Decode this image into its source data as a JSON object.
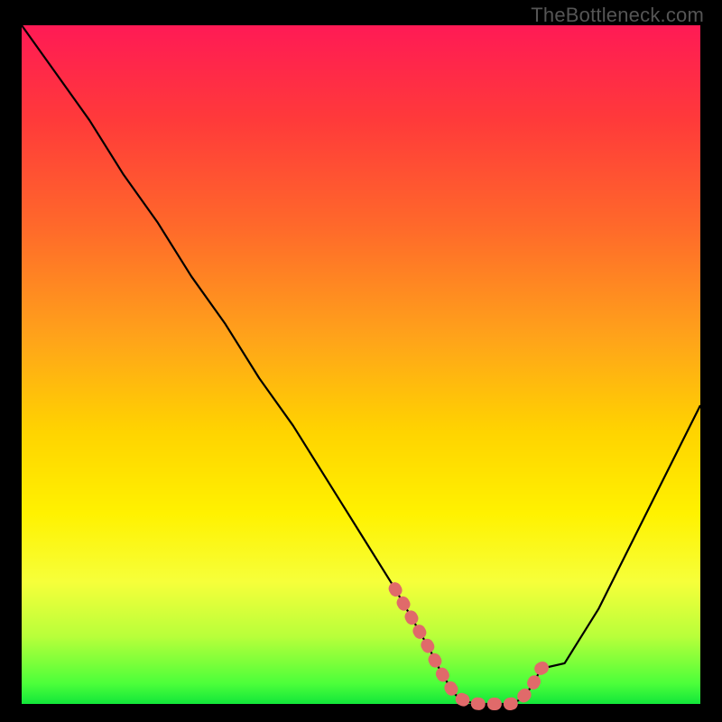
{
  "watermark": "TheBottleneck.com",
  "colors": {
    "frame": "#000000",
    "curve": "#000000",
    "highlight": "#e06a6a",
    "gradient_top": "#ff1a55",
    "gradient_bottom": "#12e63a"
  },
  "chart_data": {
    "type": "line",
    "title": "",
    "xlabel": "",
    "ylabel": "",
    "ylim": [
      0,
      100
    ],
    "x": [
      0,
      5,
      10,
      15,
      20,
      25,
      30,
      35,
      40,
      45,
      50,
      55,
      60,
      62,
      65,
      68,
      72,
      76,
      80,
      85,
      90,
      95,
      100
    ],
    "values": [
      100,
      93,
      86,
      78,
      71,
      63,
      56,
      48,
      41,
      33,
      25,
      17,
      8,
      4,
      1,
      0,
      0,
      1,
      6,
      14,
      24,
      34,
      44
    ],
    "highlight_range_x": [
      55,
      78
    ],
    "annotations": []
  }
}
